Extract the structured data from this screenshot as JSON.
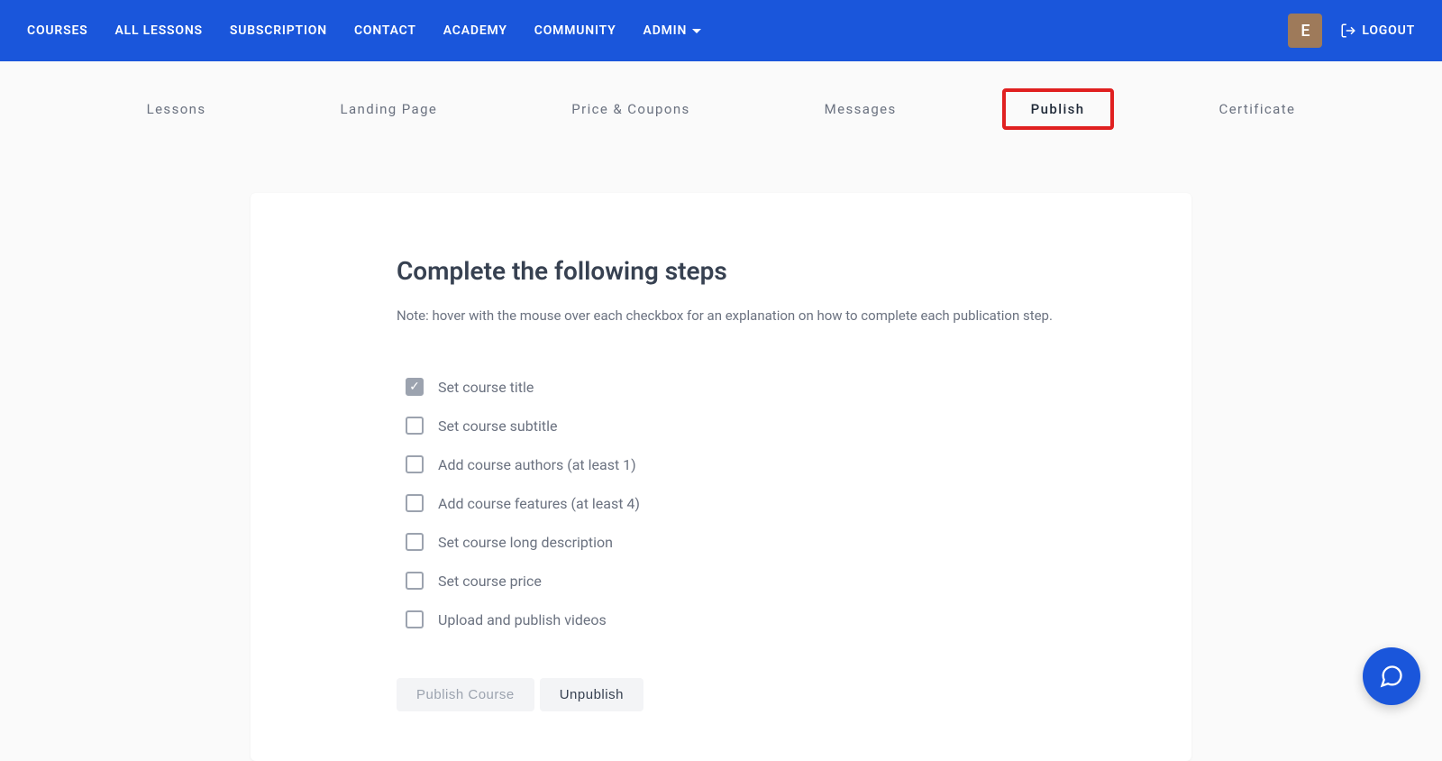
{
  "nav": {
    "items": [
      {
        "label": "COURSES"
      },
      {
        "label": "ALL LESSONS"
      },
      {
        "label": "SUBSCRIPTION"
      },
      {
        "label": "CONTACT"
      },
      {
        "label": "ACADEMY"
      },
      {
        "label": "COMMUNITY"
      },
      {
        "label": "ADMIN"
      }
    ],
    "avatar_letter": "E",
    "logout_label": "LOGOUT"
  },
  "tabs": {
    "items": [
      {
        "label": "Lessons",
        "active": false
      },
      {
        "label": "Landing Page",
        "active": false
      },
      {
        "label": "Price & Coupons",
        "active": false
      },
      {
        "label": "Messages",
        "active": false
      },
      {
        "label": "Publish",
        "active": true
      },
      {
        "label": "Certificate",
        "active": false
      }
    ]
  },
  "panel": {
    "title": "Complete the following steps",
    "note": "Note: hover with the mouse over each checkbox for an explanation on how to complete each publication step.",
    "checklist": [
      {
        "label": "Set course title",
        "checked": true
      },
      {
        "label": "Set course subtitle",
        "checked": false
      },
      {
        "label": "Add course authors (at least 1)",
        "checked": false
      },
      {
        "label": "Add course features (at least 4)",
        "checked": false
      },
      {
        "label": "Set course long description",
        "checked": false
      },
      {
        "label": "Set course price",
        "checked": false
      },
      {
        "label": "Upload and publish videos",
        "checked": false
      }
    ],
    "publish_label": "Publish Course",
    "unpublish_label": "Unpublish"
  }
}
